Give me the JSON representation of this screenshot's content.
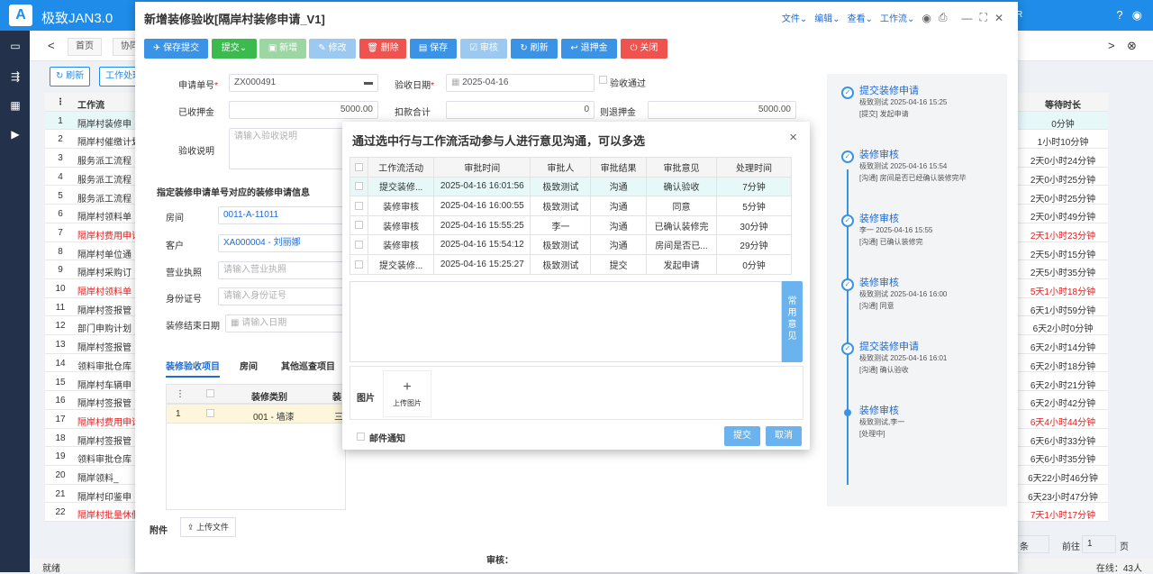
{
  "app": {
    "logo": "A",
    "name": "极致JAN3.0",
    "hint": "R",
    "help_icon": "?",
    "user_icon": "◉"
  },
  "tabs": {
    "left_arrow": "<",
    "home": "首页",
    "coop": "协同",
    "right_arrow": ">",
    "close_all": "⊗"
  },
  "toolbar": {
    "refresh": "刷新",
    "workflow": "工作处理"
  },
  "bg_table": {
    "head_no": "⋮",
    "head_title": "工作流",
    "rows": [
      {
        "n": "1",
        "t": "隔岸村装修申",
        "red": false
      },
      {
        "n": "2",
        "t": "隔岸村催缴计划",
        "red": false
      },
      {
        "n": "3",
        "t": "服务派工流程",
        "red": false
      },
      {
        "n": "4",
        "t": "服务派工流程",
        "red": false
      },
      {
        "n": "5",
        "t": "服务派工流程",
        "red": false
      },
      {
        "n": "6",
        "t": "隔岸村领料单",
        "red": false
      },
      {
        "n": "7",
        "t": "隔岸村费用申请",
        "red": true
      },
      {
        "n": "8",
        "t": "隔岸村单位通",
        "red": false
      },
      {
        "n": "9",
        "t": "隔岸村采购订",
        "red": false
      },
      {
        "n": "10",
        "t": "隔岸村领料单",
        "red": true
      },
      {
        "n": "11",
        "t": "隔岸村签报管",
        "red": false
      },
      {
        "n": "12",
        "t": "部门申购计划",
        "red": false
      },
      {
        "n": "13",
        "t": "隔岸村签报管",
        "red": false
      },
      {
        "n": "14",
        "t": "领料审批仓库",
        "red": false
      },
      {
        "n": "15",
        "t": "隔岸村车辆申",
        "red": false
      },
      {
        "n": "16",
        "t": "隔岸村签报管",
        "red": false
      },
      {
        "n": "17",
        "t": "隔岸村费用申请",
        "red": true
      },
      {
        "n": "18",
        "t": "隔岸村签报管",
        "red": false
      },
      {
        "n": "19",
        "t": "领料审批仓库",
        "red": false
      },
      {
        "n": "20",
        "t": "隔岸领料_",
        "red": false
      },
      {
        "n": "21",
        "t": "隔岸村印鉴申",
        "red": false
      },
      {
        "n": "22",
        "t": "隔岸村批量休假",
        "red": true
      }
    ]
  },
  "right_table": {
    "head": "等待时长",
    "rows": [
      {
        "v": "0分钟",
        "red": false
      },
      {
        "v": "1小时10分钟",
        "red": false
      },
      {
        "v": "2天0小时24分钟",
        "red": false
      },
      {
        "v": "2天0小时25分钟",
        "red": false
      },
      {
        "v": "2天0小时25分钟",
        "red": false
      },
      {
        "v": "2天0小时49分钟",
        "red": false
      },
      {
        "v": "2天1小时23分钟",
        "red": true
      },
      {
        "v": "2天5小时15分钟",
        "red": false
      },
      {
        "v": "2天5小时35分钟",
        "red": false
      },
      {
        "v": "5天1小时18分钟",
        "red": true
      },
      {
        "v": "6天1小时59分钟",
        "red": false
      },
      {
        "v": "6天2小时0分钟",
        "red": false
      },
      {
        "v": "6天2小时14分钟",
        "red": false
      },
      {
        "v": "6天2小时18分钟",
        "red": false
      },
      {
        "v": "6天2小时21分钟",
        "red": false
      },
      {
        "v": "6天2小时42分钟",
        "red": false
      },
      {
        "v": "6天4小时44分钟",
        "red": true
      },
      {
        "v": "6天6小时33分钟",
        "red": false
      },
      {
        "v": "6天6小时35分钟",
        "red": false
      },
      {
        "v": "6天22小时46分钟",
        "red": false
      },
      {
        "v": "6天23小时47分钟",
        "red": false
      },
      {
        "v": "7天1小时17分钟",
        "red": true
      }
    ]
  },
  "pager": {
    "prefix": "条",
    "goto": "前往",
    "page": "1",
    "suffix": "页"
  },
  "status": {
    "left": "就绪",
    "right": "在线：43人"
  },
  "main": {
    "title": "新增装修验收[隔岸村装修申请_V1]",
    "menus": [
      "文件",
      "编辑",
      "查看",
      "工作流"
    ],
    "win": {
      "eye": "◉",
      "print": "⎙",
      "min": "—",
      "max": "⛶",
      "close": "✕"
    },
    "actions": {
      "save_submit": "保存提交",
      "submit": "提交",
      "add": "新增",
      "edit": "修改",
      "delete": "删除",
      "save": "保存",
      "approve": "审核",
      "refresh": "刷新",
      "refund": "退押金",
      "close": "关闭"
    },
    "form": {
      "apply_no_label": "申请单号",
      "apply_no": "ZX000491",
      "check_date_label": "验收日期",
      "check_date": "2025-04-16",
      "passed_label": "验收通过",
      "deposit_label": "已收押金",
      "deposit": "5000.00",
      "deduct_label": "扣款合计",
      "deduct": "0",
      "refund_label": "则退押金",
      "refund": "5000.00",
      "remark_label": "验收说明",
      "remark_placeholder": "请输入验收说明",
      "section_title": "指定装修申请单号对应的装修申请信息",
      "room_label": "房间",
      "room": "0011-A-11011",
      "customer_label": "客户",
      "customer": "XA000004 - 刘丽娜",
      "license_label": "营业执照",
      "license_placeholder": "请输入营业执照",
      "idcard_label": "身份证号",
      "idcard_placeholder": "请输入身份证号",
      "enddate_label": "装修结束日期",
      "enddate_placeholder": "请输入日期"
    },
    "subtabs": [
      "装修验收项目",
      "房间",
      "其他巡查项目"
    ],
    "grid": {
      "col_type": "装修类别",
      "col_more": "装",
      "row_no": "1",
      "row_type": "001 - 墙漆",
      "row_more": "三"
    },
    "attach_label": "附件",
    "upload_label": "上传文件",
    "review_label": "审核："
  },
  "flow": [
    {
      "title": "提交装修申请",
      "line1": "极致测试 2025-04-16 15:25",
      "line2": "[提交] 发起申请"
    },
    {
      "title": "装修审核",
      "line1": "极致测试 2025-04-16 15:54",
      "line2": "[沟通] 房间是否已经确认装修完毕"
    },
    {
      "title": "装修审核",
      "line1": "李一 2025-04-16 15:55",
      "line2": "[沟通] 已确认装修完"
    },
    {
      "title": "装修审核",
      "line1": "极致测试 2025-04-16 16:00",
      "line2": "[沟通] 同意"
    },
    {
      "title": "提交装修申请",
      "line1": "极致测试 2025-04-16 16:01",
      "line2": "[沟通] 确认验收"
    },
    {
      "title": "装修审核",
      "line1": "极致测试,李一",
      "line2": "[处理中]"
    }
  ],
  "dialog": {
    "title": "通过选中行与工作流活动参与人进行意见沟通，可以多选",
    "close": "×",
    "headers": [
      "工作流活动",
      "审批时间",
      "审批人",
      "审批结果",
      "审批意见",
      "处理时间"
    ],
    "rows": [
      [
        "提交装修...",
        "2025-04-16 16:01:56",
        "极致测试",
        "沟通",
        "确认验收",
        "7分钟"
      ],
      [
        "装修审核",
        "2025-04-16 16:00:55",
        "极致测试",
        "沟通",
        "同意",
        "5分钟"
      ],
      [
        "装修审核",
        "2025-04-16 15:55:25",
        "李一",
        "沟通",
        "已确认装修完",
        "30分钟"
      ],
      [
        "装修审核",
        "2025-04-16 15:54:12",
        "极致测试",
        "沟通",
        "房间是否已...",
        "29分钟"
      ],
      [
        "提交装修...",
        "2025-04-16 15:25:27",
        "极致测试",
        "提交",
        "发起申请",
        "0分钟"
      ]
    ],
    "common_opinion": "常用意见",
    "image_label": "图片",
    "upload_image": "上传图片",
    "mail_label": "邮件通知",
    "submit": "提交",
    "cancel": "取消"
  }
}
